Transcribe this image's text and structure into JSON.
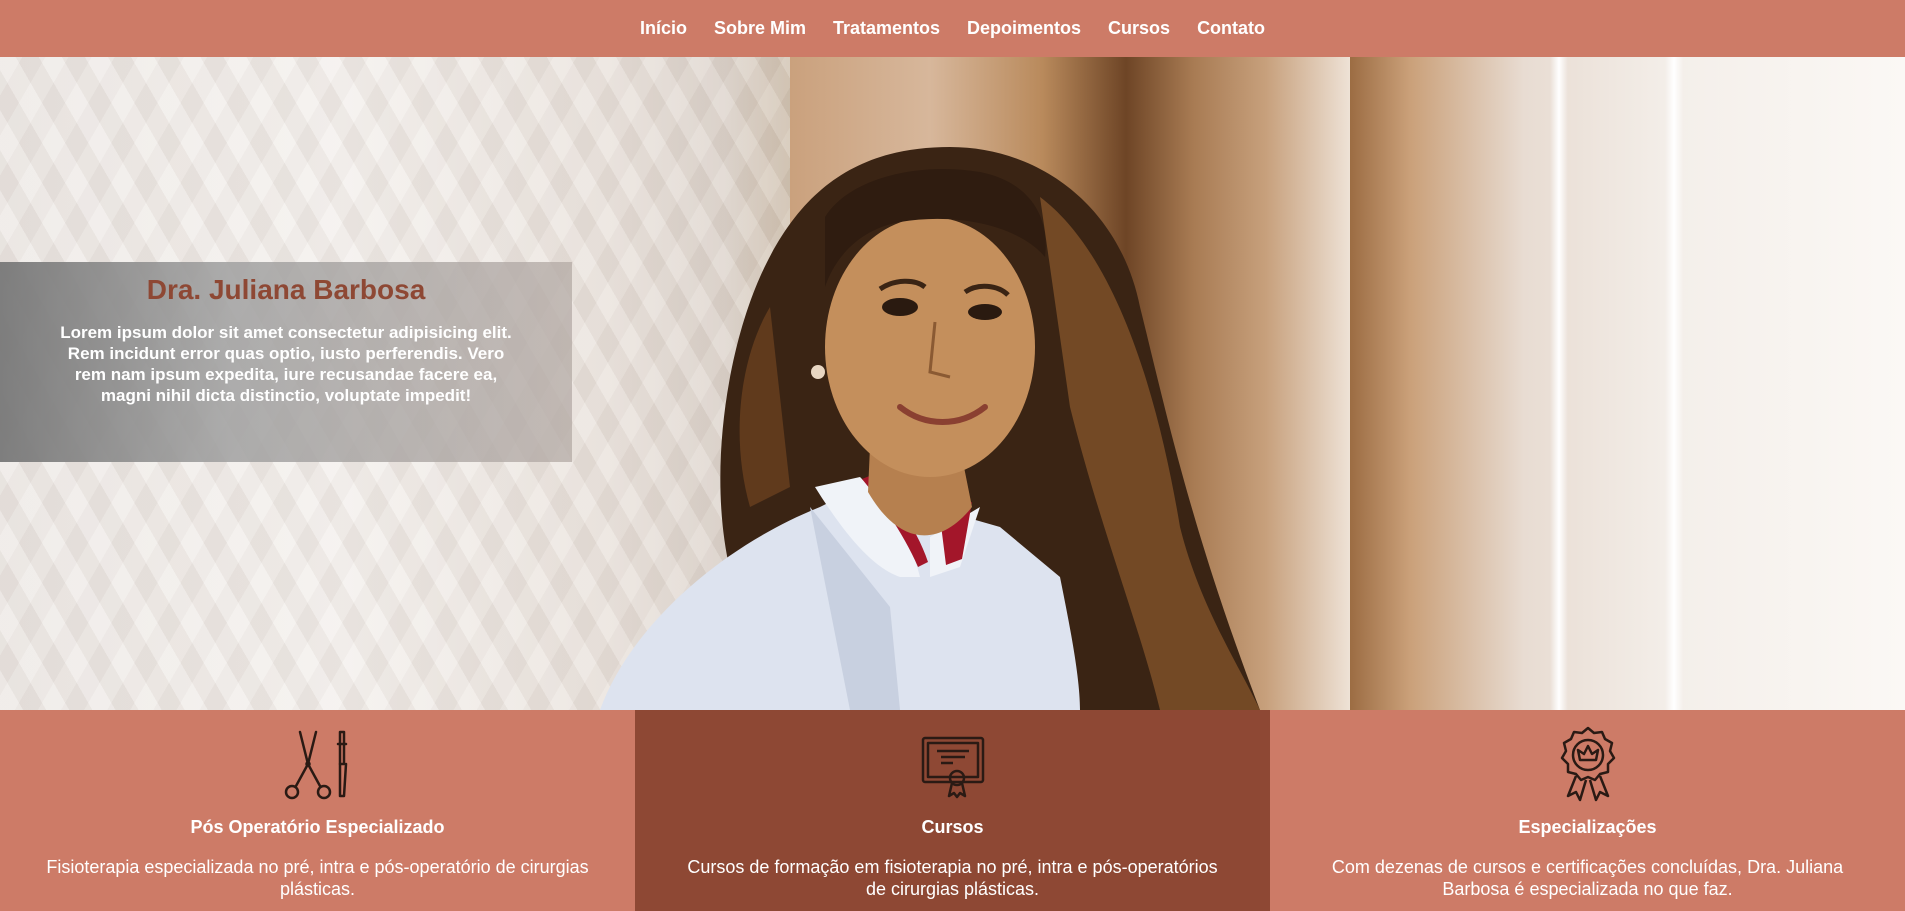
{
  "nav": {
    "items": [
      {
        "label": "Início"
      },
      {
        "label": "Sobre Mim"
      },
      {
        "label": "Tratamentos"
      },
      {
        "label": "Depoimentos"
      },
      {
        "label": "Cursos"
      },
      {
        "label": "Contato"
      }
    ]
  },
  "hero": {
    "title": "Dra. Juliana Barbosa",
    "text": "Lorem ipsum dolor sit amet consectetur adipisicing elit. Rem incidunt error quas optio, iusto perferendis. Vero rem nam ipsum expedita, iure recusandae facere ea, magni nihil dicta distinctio, voluptate impedit!"
  },
  "features": [
    {
      "icon": "surgical-tools-icon",
      "title": "Pós Operatório Especializado",
      "text": "Fisioterapia especializada no pré, intra e pós-operatório de cirurgias plásticas."
    },
    {
      "icon": "certificate-icon",
      "title": "Cursos",
      "text": "Cursos de formação em fisioterapia no pré, intra e pós-operatórios de cirurgias plásticas."
    },
    {
      "icon": "award-badge-icon",
      "title": "Especializações",
      "text": "Com dezenas de cursos e certificações concluídas, Dra. Juliana Barbosa é especializada no que faz."
    }
  ],
  "colors": {
    "brand": "#cd7b67",
    "brand_dark": "#8e4834",
    "text_light": "#ffffff"
  }
}
